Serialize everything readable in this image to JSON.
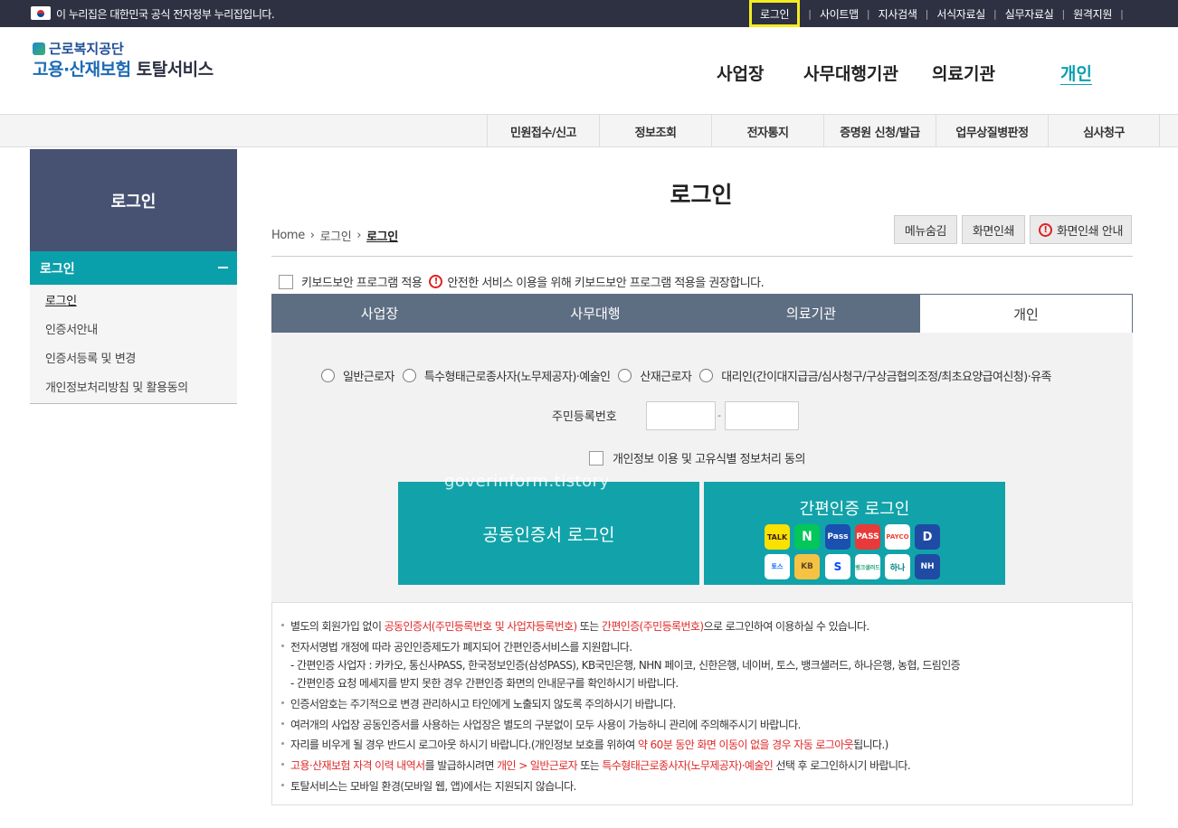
{
  "gov_banner": "이 누리집은 대한민국 공식 전자정부 누리집입니다.",
  "util_links": [
    "로그인",
    "사이트맵",
    "지사검색",
    "서식자료실",
    "실무자료실",
    "원격지원"
  ],
  "logo": {
    "top": "근로복지공단",
    "main_blue": "고용·산재보험",
    "main_dark": "토탈서비스"
  },
  "gnb": [
    "사업장",
    "사무대행기관",
    "의료기관",
    "개인"
  ],
  "subnav": [
    "민원접수/신고",
    "정보조회",
    "전자통지",
    "증명원 신청/발급",
    "업무상질병판정",
    "심사청구"
  ],
  "sidebar": {
    "title": "로그인",
    "active": "로그인",
    "items": [
      "로그인",
      "인증서안내",
      "인증서등록 및 변경",
      "개인정보처리방침 및 활용동의"
    ]
  },
  "page_title": "로그인",
  "breadcrumb": [
    "Home",
    "로그인",
    "로그인"
  ],
  "buttons": {
    "hide_menu": "메뉴숨김",
    "print": "화면인쇄",
    "print_guide": "화면인쇄 안내",
    "warn_glyph": "!"
  },
  "keyboard": {
    "label": "키보드보안 프로그램 적용",
    "notice": "안전한 서비스 이용을 위해 키보드보안 프로그램 적용을 권장합니다."
  },
  "tabs": [
    "사업장",
    "사무대행",
    "의료기관",
    "개인"
  ],
  "radios": [
    "일반근로자",
    "특수형태근로종사자(노무제공자)·예술인",
    "산재근로자",
    "대리인(간이대지급금/심사청구/구상금협의조정/최초요양급여신청)·유족"
  ],
  "rrn_label": "주민등록번호",
  "rrn_dash": "-",
  "agree_label": "개인정보 이용 및 고유식별 정보처리 동의",
  "cert_login": "공동인증서 로그인",
  "easy_login": "간편인증 로그인",
  "easy_providers": [
    "TALK",
    "N",
    "Pass",
    "PASS",
    "PAYCO",
    "D",
    "토스",
    "KB",
    "S",
    "뱅크샐러드",
    "하나",
    "NH"
  ],
  "watermark": "goverinform.tistory",
  "notes": {
    "n1": [
      "별도의 회원가입 없이 ",
      "공동인증서(주민등록번호 및 사업자등록번호)",
      " 또는 ",
      "간편인증(주민등록번호)",
      "으로 로그인하여 이용하실 수 있습니다."
    ],
    "n2": "전자서명법 개정에 따라 공인인증제도가 폐지되어 간편인증서비스를 지원합니다.",
    "n2a": "- 간편인증 사업자 : 카카오, 통신사PASS, 한국정보인증(삼성PASS), KB국민은행, NHN 페이코, 신한은행, 네이버, 토스, 뱅크샐러드, 하나은행, 농협, 드림인증",
    "n2b": "- 간편인증 요청 메세지를 받지 못한 경우 간편인증 화면의 안내문구를 확인하시기 바랍니다.",
    "n3": "인증서암호는 주기적으로 변경 관리하시고 타인에게 노출되지 않도록 주의하시기 바랍니다.",
    "n4": "여러개의 사업장 공동인증서를 사용하는 사업장은 별도의 구분없이 모두 사용이 가능하니 관리에 주의해주시기 바랍니다.",
    "n5": [
      "자리를 비우게 될 경우 반드시 로그아웃 하시기 바랍니다.(개인정보 보호를 위하여 ",
      "약 60분 동안 화면 이동이 없을 경우 자동 로그아웃",
      "됩니다.)"
    ],
    "n6": [
      "고용·산재보험 자격 이력 내역서",
      "를 발급하시려면 ",
      "개인 > 일반근로자",
      " 또는 ",
      "특수형태근로종사자(노무제공자)·예술인",
      " 선택 후 로그인하시기 바랍니다."
    ],
    "n7": "토탈서비스는 모바일 환경(모바일 웹, 앱)에서는 지원되지 않습니다."
  }
}
